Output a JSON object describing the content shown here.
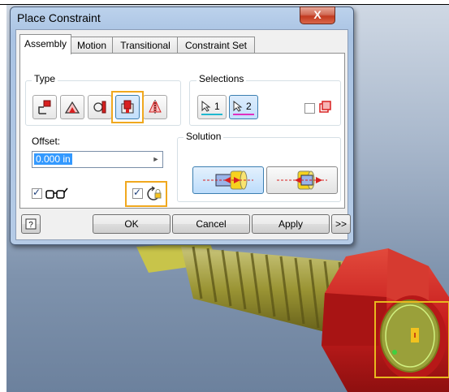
{
  "dialog": {
    "title": "Place Constraint",
    "close_label": "X"
  },
  "tabs": [
    {
      "label": "Assembly",
      "active": true
    },
    {
      "label": "Motion",
      "active": false
    },
    {
      "label": "Transitional",
      "active": false
    },
    {
      "label": "Constraint Set",
      "active": false
    }
  ],
  "type_group": {
    "label": "Type",
    "buttons": [
      {
        "icon": "mate-icon",
        "selected": false
      },
      {
        "icon": "angle-icon",
        "selected": false
      },
      {
        "icon": "tangent-icon",
        "selected": false
      },
      {
        "icon": "insert-icon",
        "selected": true
      },
      {
        "icon": "symmetry-icon",
        "selected": false
      }
    ]
  },
  "selections_group": {
    "label": "Selections",
    "select1_label": "1",
    "select2_label": "2",
    "first_occurrence_checked": false
  },
  "offset": {
    "label": "Offset:",
    "value": "0.000 in"
  },
  "solution_group": {
    "label": "Solution",
    "options": [
      {
        "icon": "opposed-icon",
        "selected": true
      },
      {
        "icon": "aligned-icon",
        "selected": false
      }
    ]
  },
  "options": {
    "show_preview_checked": true,
    "lock_rotation_checked": true
  },
  "footer": {
    "help_icon": "help-icon",
    "ok_label": "OK",
    "cancel_label": "Cancel",
    "apply_label": "Apply",
    "more_label": ">>"
  },
  "colors": {
    "highlight": "#f0a81e",
    "bolt_thread": "#9a9434",
    "nut_red": "#c81e1e",
    "selection_yellow": "#e8b81e",
    "tab_panel_bg": "#ffffff"
  }
}
